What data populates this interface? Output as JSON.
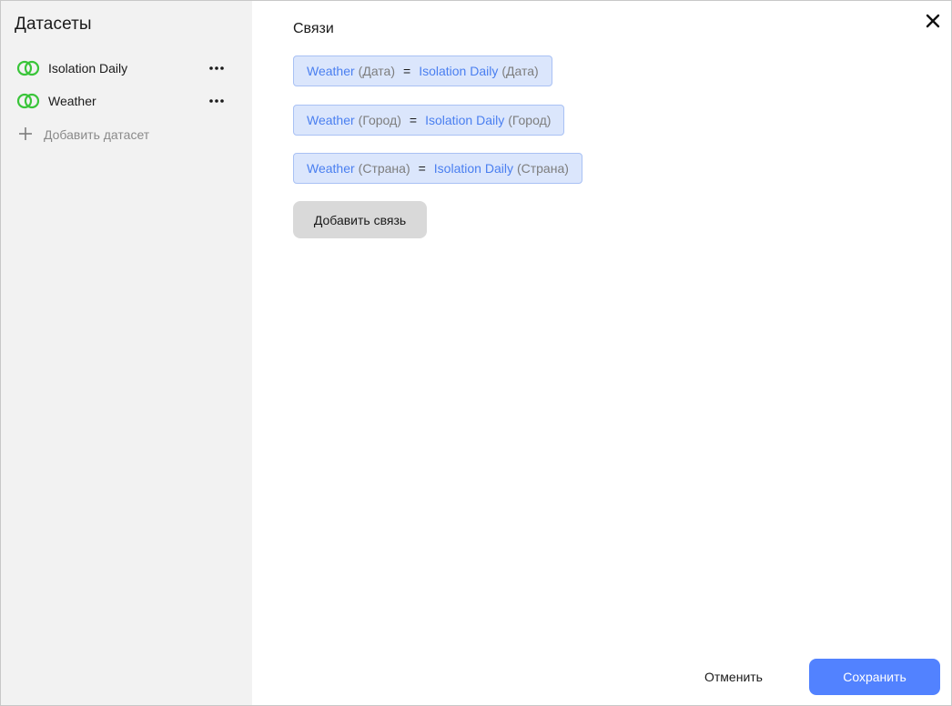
{
  "sidebar": {
    "title": "Датасеты",
    "datasets": [
      {
        "label": "Isolation Daily",
        "icon": "dataset-rings-icon",
        "menu_icon": "more-horizontal-icon"
      },
      {
        "label": "Weather",
        "icon": "dataset-rings-icon",
        "menu_icon": "more-horizontal-icon"
      }
    ],
    "add_dataset_label": "Добавить датасет",
    "add_dataset_icon": "plus-icon"
  },
  "main": {
    "title": "Связи",
    "close_icon": "close-icon",
    "relations": [
      {
        "left_dataset": "Weather",
        "left_field": "(Дата)",
        "operator": "=",
        "right_dataset": "Isolation Daily",
        "right_field": "(Дата)"
      },
      {
        "left_dataset": "Weather",
        "left_field": "(Город)",
        "operator": "=",
        "right_dataset": "Isolation Daily",
        "right_field": "(Город)"
      },
      {
        "left_dataset": "Weather",
        "left_field": "(Страна)",
        "operator": "=",
        "right_dataset": "Isolation Daily",
        "right_field": "(Страна)"
      }
    ],
    "add_relation_label": "Добавить связь"
  },
  "footer": {
    "cancel_label": "Отменить",
    "save_label": "Сохранить"
  },
  "colors": {
    "accent": "#5282ff",
    "dataset_icon": "#3ac53a",
    "relation_bg": "#dbe6fc",
    "relation_border": "#a9c1f4",
    "relation_link": "#4a7ff0",
    "sidebar_bg": "#f2f2f2"
  }
}
